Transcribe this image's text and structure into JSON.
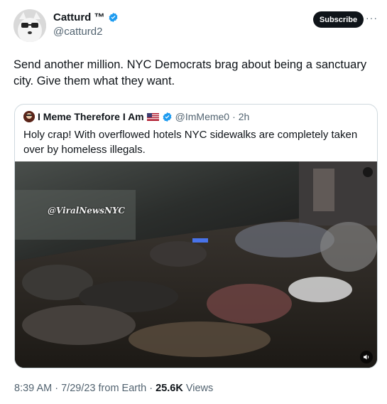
{
  "author": {
    "name": "Catturd ™",
    "handle": "@catturd2",
    "verified": true,
    "avatar_icon": "cat-avatar-icon"
  },
  "actions": {
    "subscribe_label": "Subscribe",
    "more_icon": "more-icon"
  },
  "tweet": {
    "text": "Send another million. NYC Democrats brag about being a sanctuary city. Give them what they want."
  },
  "quoted": {
    "name": "I Meme Therefore I Am",
    "handle": "@ImMeme0",
    "separator": "·",
    "time": "2h",
    "text": "Holy crap! With overflowed hotels NYC sidewalks are completely taken over by homeless illegals.",
    "media": {
      "watermark": "@ViralNewsNYC",
      "sound_icon": "speaker-icon"
    }
  },
  "meta": {
    "time": "8:39 AM",
    "date": "7/29/23",
    "source": "from Earth",
    "views": "25.6K",
    "views_label": "Views",
    "separator": "·"
  },
  "colors": {
    "verified": "#1d9bf0",
    "subscribe_bg": "#0f1419",
    "secondary_text": "#536471",
    "border": "#cfd9de"
  }
}
